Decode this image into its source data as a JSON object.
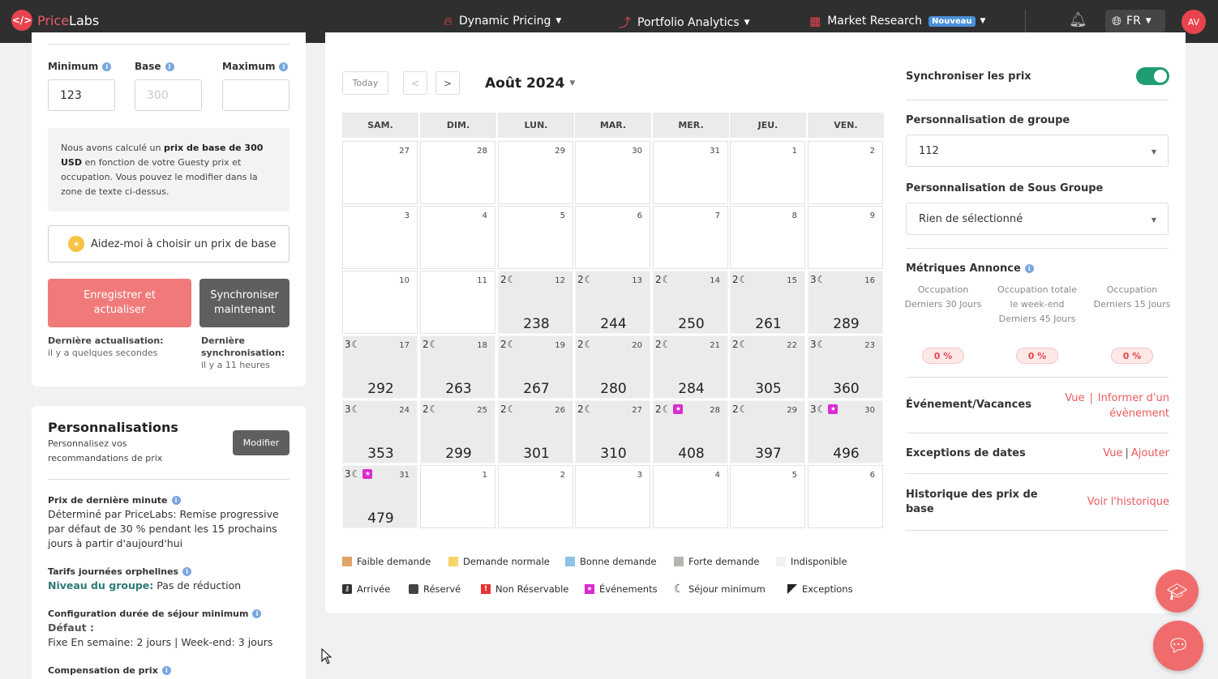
{
  "nav": {
    "logo_a": "Price",
    "logo_b": "Labs",
    "items": [
      {
        "label": "Dynamic Pricing",
        "icon": "flame-icon"
      },
      {
        "label": "Portfolio Analytics",
        "icon": "trend-icon"
      },
      {
        "label": "Market Research",
        "icon": "grid-icon",
        "badge": "Nouveau"
      }
    ],
    "language": "FR",
    "avatar": "AV"
  },
  "pricing": {
    "min_label": "Minimum",
    "base_label": "Base",
    "max_label": "Maximum",
    "min_value": "123",
    "base_placeholder": "300",
    "max_value": "",
    "note_a": "Nous avons calculé un ",
    "note_b": "prix de base de 300 USD",
    "note_c": " en fonction de votre Guesty prix et occupation. Vous pouvez le modifier dans la zone de texte ci-dessus.",
    "help_label": "Aidez-moi à choisir un prix de base",
    "save_label": "Enregistrer et actualiser",
    "sync_label": "Synchroniser maintenant",
    "last_update_label": "Dernière actualisation:",
    "last_update_value": "il y a quelques secondes",
    "last_sync_label": "Dernière synchronisation:",
    "last_sync_value": "il y a 11 heures"
  },
  "personalisations": {
    "title": "Personnalisations",
    "subtitle": "Personnalisez vos recommandations de prix",
    "modify_label": "Modifier",
    "last_minute_h": "Prix de dernière minute",
    "last_minute_t": "Déterminé par PriceLabs: Remise progressive par défaut de 30 % pendant les 15 prochains jours à partir d'aujourd'hui",
    "orphan_h": "Tarifs journées orphelines",
    "orphan_level": "Niveau du groupe:",
    "orphan_value": " Pas de réduction",
    "minstay_h": "Configuration durée de séjour minimum",
    "minstay_default": "Défaut :",
    "minstay_value": "Fixe En semaine: 2 jours | Week-end: 3 jours",
    "comp_h": "Compensation de prix"
  },
  "calendar": {
    "today_label": "Today",
    "prev": "<",
    "next": ">",
    "month": "Août 2024",
    "weekdays": [
      "SAM.",
      "DIM.",
      "LUN.",
      "MAR.",
      "MER.",
      "JEU.",
      "VEN."
    ],
    "weeks": [
      [
        {
          "d": "27"
        },
        {
          "d": "28"
        },
        {
          "d": "29"
        },
        {
          "d": "30"
        },
        {
          "d": "31"
        },
        {
          "d": "1"
        },
        {
          "d": "2"
        }
      ],
      [
        {
          "d": "3"
        },
        {
          "d": "4"
        },
        {
          "d": "5"
        },
        {
          "d": "6"
        },
        {
          "d": "7"
        },
        {
          "d": "8"
        },
        {
          "d": "9"
        }
      ],
      [
        {
          "d": "10"
        },
        {
          "d": "11"
        },
        {
          "d": "12",
          "ms": "2",
          "p": "238"
        },
        {
          "d": "13",
          "ms": "2",
          "p": "244"
        },
        {
          "d": "14",
          "ms": "2",
          "p": "250"
        },
        {
          "d": "15",
          "ms": "2",
          "p": "261"
        },
        {
          "d": "16",
          "ms": "3",
          "p": "289"
        }
      ],
      [
        {
          "d": "17",
          "ms": "3",
          "p": "292"
        },
        {
          "d": "18",
          "ms": "2",
          "p": "263"
        },
        {
          "d": "19",
          "ms": "2",
          "p": "267"
        },
        {
          "d": "20",
          "ms": "2",
          "p": "280"
        },
        {
          "d": "21",
          "ms": "2",
          "p": "284"
        },
        {
          "d": "22",
          "ms": "2",
          "p": "305"
        },
        {
          "d": "23",
          "ms": "3",
          "p": "360"
        }
      ],
      [
        {
          "d": "24",
          "ms": "3",
          "p": "353"
        },
        {
          "d": "25",
          "ms": "2",
          "p": "299"
        },
        {
          "d": "26",
          "ms": "2",
          "p": "301"
        },
        {
          "d": "27",
          "ms": "2",
          "p": "310"
        },
        {
          "d": "28",
          "ms": "2",
          "p": "408",
          "ev": true
        },
        {
          "d": "29",
          "ms": "2",
          "p": "397"
        },
        {
          "d": "30",
          "ms": "3",
          "p": "496",
          "ev": true
        }
      ],
      [
        {
          "d": "31",
          "ms": "3",
          "p": "479",
          "ev": true
        },
        {
          "d": "1"
        },
        {
          "d": "2"
        },
        {
          "d": "3"
        },
        {
          "d": "4"
        },
        {
          "d": "5"
        },
        {
          "d": "6"
        }
      ]
    ],
    "legend_demand": [
      {
        "label": "Faible demande",
        "color": "#e2a36b"
      },
      {
        "label": "Demande normale",
        "color": "#f5d46a"
      },
      {
        "label": "Bonne demande",
        "color": "#8ec2e6"
      },
      {
        "label": "Forte demande",
        "color": "#b3b7ad"
      },
      {
        "label": "Indisponible",
        "color": "#f1f1f1"
      }
    ],
    "legend_marks": [
      {
        "label": "Arrivée",
        "icon": "key-icon"
      },
      {
        "label": "Réservé",
        "icon": "booked-icon"
      },
      {
        "label": "Non Réservable",
        "icon": "warning-icon"
      },
      {
        "label": "Événements",
        "icon": "event-star-icon"
      },
      {
        "label": "Séjour minimum",
        "icon": "moon-icon"
      },
      {
        "label": "Exceptions",
        "icon": "corner-icon"
      }
    ]
  },
  "right": {
    "sync_label": "Synchroniser les prix",
    "group_label": "Personnalisation de groupe",
    "group_value": "112",
    "subgroup_label": "Personnalisation de Sous Groupe",
    "subgroup_value": "Rien de sélectionné",
    "metrics_label": "Métriques Annonce",
    "metrics": [
      {
        "label": "Occupation Derniers 30 Jours",
        "value": "0 %"
      },
      {
        "label": "Occupation totale le week-end Derniers 45 Jours",
        "value": "0 %"
      },
      {
        "label": "Occupation Derniers 15 Jours",
        "value": "0 %"
      }
    ],
    "events_label": "Événement/Vacances",
    "events_view": "Vue",
    "events_inform": "Informer d'un évènement",
    "exceptions_label": "Exceptions de dates",
    "exceptions_view": "Vue",
    "exceptions_add": "Ajouter",
    "history_label": "Historique des prix de base",
    "history_link": "Voir l'historique"
  }
}
